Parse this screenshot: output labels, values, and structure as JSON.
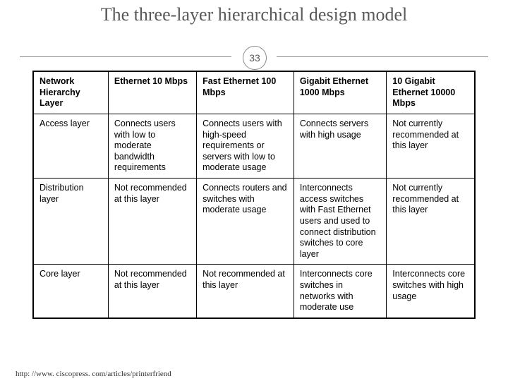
{
  "title": "The three-layer hierarchical design model",
  "slide_number": "33",
  "footer_url": "http: //www. ciscopress. com/articles/printerfriend",
  "table": {
    "headers": [
      "Network Hierarchy Layer",
      "Ethernet 10 Mbps",
      "Fast Ethernet 100 Mbps",
      "Gigabit Ethernet 1000 Mbps",
      "10 Gigabit Ethernet 10000 Mbps"
    ],
    "rows": [
      [
        "Access layer",
        "Connects users with low to moderate bandwidth requirements",
        "Connects users with high-speed requirements or servers with low to moderate usage",
        "Connects servers with high usage",
        "Not currently recommended at this layer"
      ],
      [
        "Distribution layer",
        "Not recommended at this layer",
        "Connects routers and switches with moderate usage",
        "Interconnects access switches with Fast Ethernet users and used to connect distribution switches to core layer",
        "Not currently recommended at this layer"
      ],
      [
        "Core layer",
        "Not recommended at this layer",
        "Not recommended at this layer",
        "Interconnects core switches in networks with moderate use",
        "Interconnects core switches with high usage"
      ]
    ]
  }
}
